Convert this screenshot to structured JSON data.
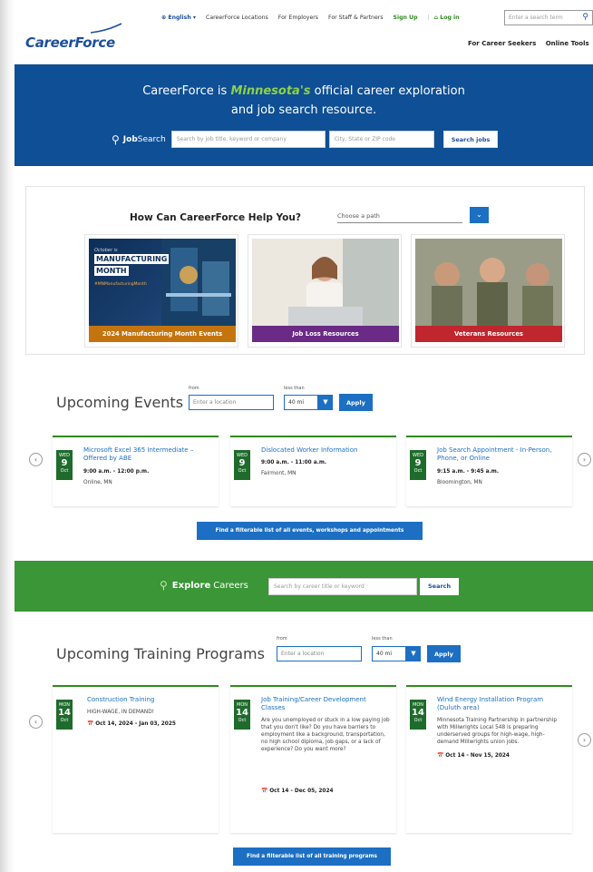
{
  "header": {
    "logo": "CareerForce",
    "top_nav": [
      {
        "id": "english",
        "label": "⊕ English ▾"
      },
      {
        "id": "locations",
        "label": "CareerForce Locations"
      },
      {
        "id": "employers",
        "label": "For Employers"
      },
      {
        "id": "staff",
        "label": "For Staff & Partners"
      },
      {
        "id": "signup",
        "label": "Sign Up"
      },
      {
        "id": "login",
        "label": "⌂ Log in"
      }
    ],
    "search_placeholder": "Enter a search term",
    "sub_nav": [
      "For Career Seekers",
      "Online Tools"
    ]
  },
  "hero": {
    "line1_pre": "CareerForce is ",
    "line1_highlight": "Minnesota's",
    "line1_post": " official career exploration",
    "line2": "and job search resource.",
    "job_label_bold": "Job",
    "job_label_rest": " Search",
    "keyword_placeholder": "Search by job title, keyword or company",
    "location_placeholder": "City, State or ZIP code",
    "search_button": "Search jobs"
  },
  "help": {
    "title": "How Can CareerForce Help You?",
    "path_placeholder": "Choose a path",
    "tiles": [
      {
        "caption": "2024 Manufacturing Month Events",
        "color": "#c4740f",
        "img_lines": [
          "October is",
          "MANUFACTURING",
          "MONTH"
        ],
        "img_tag": "#MNManufacturingMonth"
      },
      {
        "caption": "Job Loss Resources",
        "color": "#6a2a86"
      },
      {
        "caption": "Veterans Resources",
        "color": "#c0262e"
      }
    ]
  },
  "events": {
    "title": "Upcoming Events",
    "from_label": "from",
    "less_label": "less than",
    "location_placeholder": "Enter a location",
    "distance": "40 mi",
    "apply": "Apply",
    "cards": [
      {
        "dow": "WED",
        "day": "9",
        "mon": "Oct",
        "title": "Microsoft Excel 365 Intermediate – Offered by ABE",
        "time": "9:00 a.m. - 12:00 p.m.",
        "place": "Online, MN"
      },
      {
        "dow": "WED",
        "day": "9",
        "mon": "Oct",
        "title": "Dislocated Worker Information",
        "time": "9:00 a.m. - 11:00 a.m.",
        "place": "Fairmont, MN"
      },
      {
        "dow": "WED",
        "day": "9",
        "mon": "Oct",
        "title": "Job Search Appointment - In-Person, Phone, or Online",
        "time": "9:15 a.m. - 9:45 a.m.",
        "place": "Bloomington, MN"
      }
    ],
    "all_button": "Find a filterable list of all events, workshops and appointments"
  },
  "explore": {
    "bold": "Explore",
    "rest": "Careers",
    "placeholder": "Search by career title or keyword",
    "button": "Search"
  },
  "training": {
    "title": "Upcoming Training Programs",
    "from_label": "from",
    "less_label": "less than",
    "location_placeholder": "Enter a location",
    "distance": "40 mi",
    "apply": "Apply",
    "cards": [
      {
        "dow": "MON",
        "day": "14",
        "mon": "Oct",
        "title": "Construction Training",
        "desc": "HIGH-WAGE, IN DEMAND!",
        "dates": "Oct 14, 2024 - Jan 03, 2025"
      },
      {
        "dow": "MON",
        "day": "14",
        "mon": "Oct",
        "title": "Job Training/Career Development Classes",
        "desc": "Are you unemployed or stuck in a low paying job that you don't like? Do you have barriers to employment like a background, transportation, no high school diploma, job gaps, or a lack of experience? Do you want more?",
        "dates": "Oct 14 - Dec 05, 2024"
      },
      {
        "dow": "MON",
        "day": "14",
        "mon": "Oct",
        "title": "Wind Energy Installation Program (Duluth area)",
        "desc": "Minnesota Training Partnership in partnership with Millwrights Local 548 is preparing underserved groups for high-wage, high-demand Millwrights union jobs.",
        "dates": "Oct 14 - Nov 15, 2024"
      }
    ],
    "all_button": "Find a filterable list of all training programs"
  }
}
